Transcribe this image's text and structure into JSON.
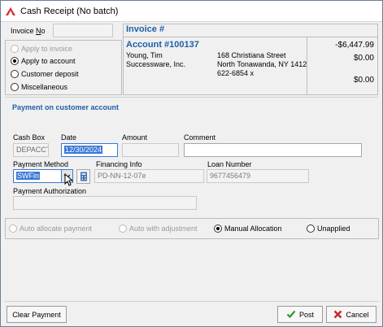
{
  "window": {
    "title": "Cash Receipt (No batch)"
  },
  "invoice_no": {
    "label": "Invoice No",
    "value": ""
  },
  "apply_options": [
    {
      "label": "Apply to invoice",
      "selected": false,
      "enabled": false
    },
    {
      "label": "Apply to account",
      "selected": true,
      "enabled": true
    },
    {
      "label": "Customer deposit",
      "selected": false,
      "enabled": true
    },
    {
      "label": "Miscellaneous",
      "selected": false,
      "enabled": true
    }
  ],
  "invoice": {
    "header": "Invoice #",
    "account": "Account #100137",
    "customer_name": "Young, Tim",
    "company": "Successware, Inc.",
    "street": "168 Christiana Street",
    "city_state": "North Tonawanda, NY  1412",
    "phone": "622-6854 x",
    "amounts": [
      "-$6,447.99",
      "$0.00",
      "$0.00"
    ]
  },
  "payment_section": {
    "title": "Payment on customer account"
  },
  "cash_box": {
    "label": "Cash Box",
    "value": "DEPACCT"
  },
  "date": {
    "label": "Date",
    "value": "12/30/2024"
  },
  "amount": {
    "label": "Amount",
    "value": ""
  },
  "comment": {
    "label": "Comment",
    "value": ""
  },
  "payment_method": {
    "label": "Payment Method",
    "value": "SWFin"
  },
  "financing_info": {
    "label": "Financing Info",
    "value": "PD-NN-12-07e"
  },
  "loan_number": {
    "label": "Loan Number",
    "value": "9677456479"
  },
  "payment_authorization": {
    "label": "Payment Authorization",
    "value": ""
  },
  "allocation_options": [
    {
      "label": "Auto allocate payment",
      "selected": false,
      "enabled": false
    },
    {
      "label": "Auto with adjustment",
      "selected": false,
      "enabled": false
    },
    {
      "label": "Manual Allocation",
      "selected": true,
      "enabled": true
    },
    {
      "label": "Unapplied",
      "selected": false,
      "enabled": true
    }
  ],
  "buttons": {
    "clear": "Clear Payment",
    "post": "Post",
    "cancel": "Cancel"
  },
  "colors": {
    "accent": "#1f5fa6",
    "selection": "#3a78d8",
    "check": "#2d9a2d",
    "cancel_x": "#c62828"
  }
}
